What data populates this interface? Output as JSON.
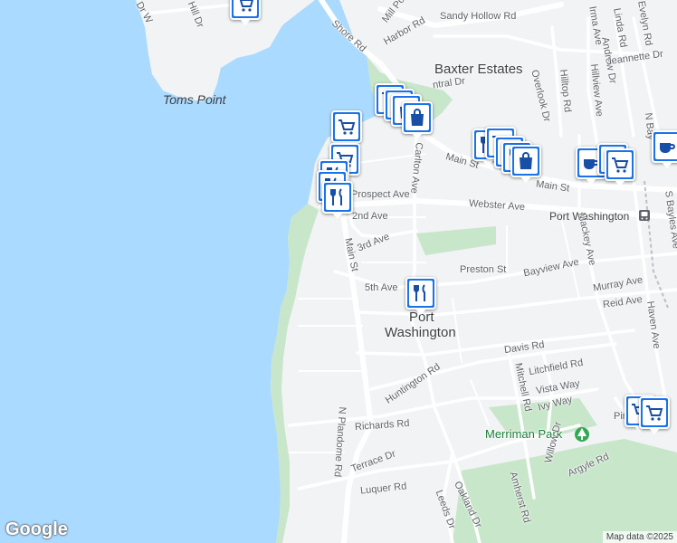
{
  "map": {
    "places": {
      "baxter_estates": "Baxter Estates",
      "toms_point": "Toms Point",
      "port_washington_l1": "Port",
      "port_washington_l2": "Washington",
      "merriman_park": "Merriman Park"
    },
    "streets": {
      "sandy_hollow": "Sandy Hollow Rd",
      "shore": "Shore Rd",
      "harbor": "Harbor Rd",
      "mill_pond": "Mill Po",
      "linda": "Linda Rd",
      "irma": "Irma Ave",
      "andrew": "Andrew Dr",
      "evelyn": "Evelyn Rd",
      "jeannette": "Jeannette Dr",
      "hillview": "Hillview Ave",
      "hilltop": "Hilltop Rd",
      "overlook": "Overlook Dr",
      "central": "ntral Dr",
      "main_st_e": "Main St",
      "main_st_e2": "Main St",
      "main_st_s": "Main St",
      "prospect": "Prospect Ave",
      "carlton": "Carlton Ave",
      "webster": "Webster Ave",
      "second": "2nd Ave",
      "third": "3rd Ave",
      "fifth": "5th Ave",
      "preston": "Preston St",
      "bayview": "Bayview Ave",
      "murray": "Murray Ave",
      "reid": "Reid Ave",
      "mackey": "Mackey Ave",
      "haven": "Haven Ave",
      "s_bayles": "S Bayles Ave",
      "n_bayles": "N Bay",
      "davis": "Davis Rd",
      "litchfield": "Litchfield Rd",
      "mitchell": "Mitchell Rd",
      "vista": "Vista Way",
      "ivy": "Ivy Way",
      "huntington": "Huntington Rd",
      "richards": "Richards Rd",
      "terrace": "Terrace Dr",
      "amherst": "Amherst Rd",
      "willow": "Willow Dr",
      "argyle": "Argyle Rd",
      "pine": "Pin",
      "luquer": "Luquer Rd",
      "oakland": "Oakland Dr",
      "leeds": "Leeds Dr",
      "n_plandome": "N Plandome Rd",
      "hill_dr": "Hill Dr",
      "dr_w": "Dr W"
    },
    "station": "Port Washington",
    "colors": {
      "water": "#aadaff",
      "land": "#f1f3f4",
      "park": "#c8e6c9",
      "road": "#ffffff",
      "poi": "#1a73e8"
    },
    "pois": [
      {
        "type": "cart-icon"
      },
      {
        "type": "shopping-bag-icon"
      },
      {
        "type": "cart-icon"
      },
      {
        "type": "restaurant-icon"
      },
      {
        "type": "restaurant-icon"
      },
      {
        "type": "restaurant-icon"
      },
      {
        "type": "restaurant-icon"
      },
      {
        "type": "shopping-bag-icon"
      },
      {
        "type": "cafe-icon"
      },
      {
        "type": "cart-icon"
      },
      {
        "type": "cafe-icon"
      },
      {
        "type": "restaurant-icon"
      },
      {
        "type": "cart-icon"
      },
      {
        "type": "cart-icon"
      }
    ]
  },
  "branding": {
    "logo": "Google",
    "attribution": "Map data ©2025"
  }
}
